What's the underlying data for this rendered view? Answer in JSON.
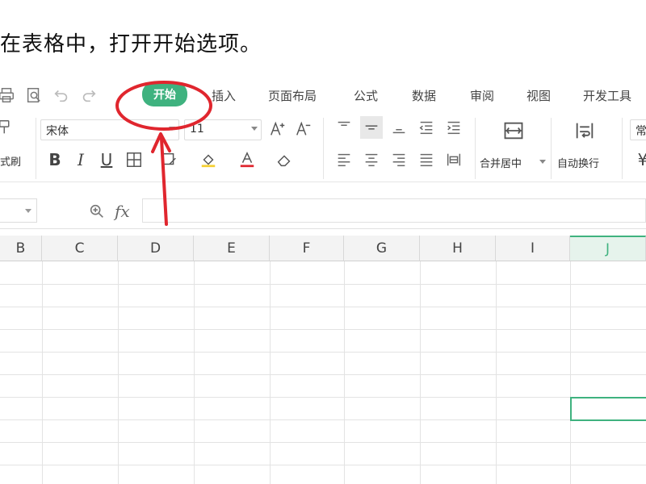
{
  "caption": "在表格中，打开开始选项。",
  "quick_access": {
    "icons": [
      "printer-icon",
      "print-preview-icon",
      "undo-icon",
      "redo-icon"
    ]
  },
  "tabs": [
    {
      "label": "开始",
      "active": true
    },
    {
      "label": "插入",
      "active": false
    },
    {
      "label": "页面布局",
      "active": false
    },
    {
      "label": "公式",
      "active": false
    },
    {
      "label": "数据",
      "active": false
    },
    {
      "label": "审阅",
      "active": false
    },
    {
      "label": "视图",
      "active": false
    },
    {
      "label": "开发工具",
      "active": false
    }
  ],
  "ribbon": {
    "format_painter_label": "式刷",
    "font_name": "宋体",
    "font_size": "11",
    "increase_font": "A+",
    "decrease_font": "A-",
    "bold": "B",
    "italic": "I",
    "underline": "U",
    "merge_center_label": "合并居中",
    "wrap_text_label": "自动换行",
    "number_format_partial": "常",
    "currency_partial": "¥"
  },
  "formula_bar": {
    "fx_label": "fx",
    "formula_value": ""
  },
  "columns": [
    "B",
    "C",
    "D",
    "E",
    "F",
    "G",
    "H",
    "I",
    "J"
  ],
  "selected_column": "J",
  "colors": {
    "accent": "#3fb27f",
    "annotation": "#e0262e"
  }
}
